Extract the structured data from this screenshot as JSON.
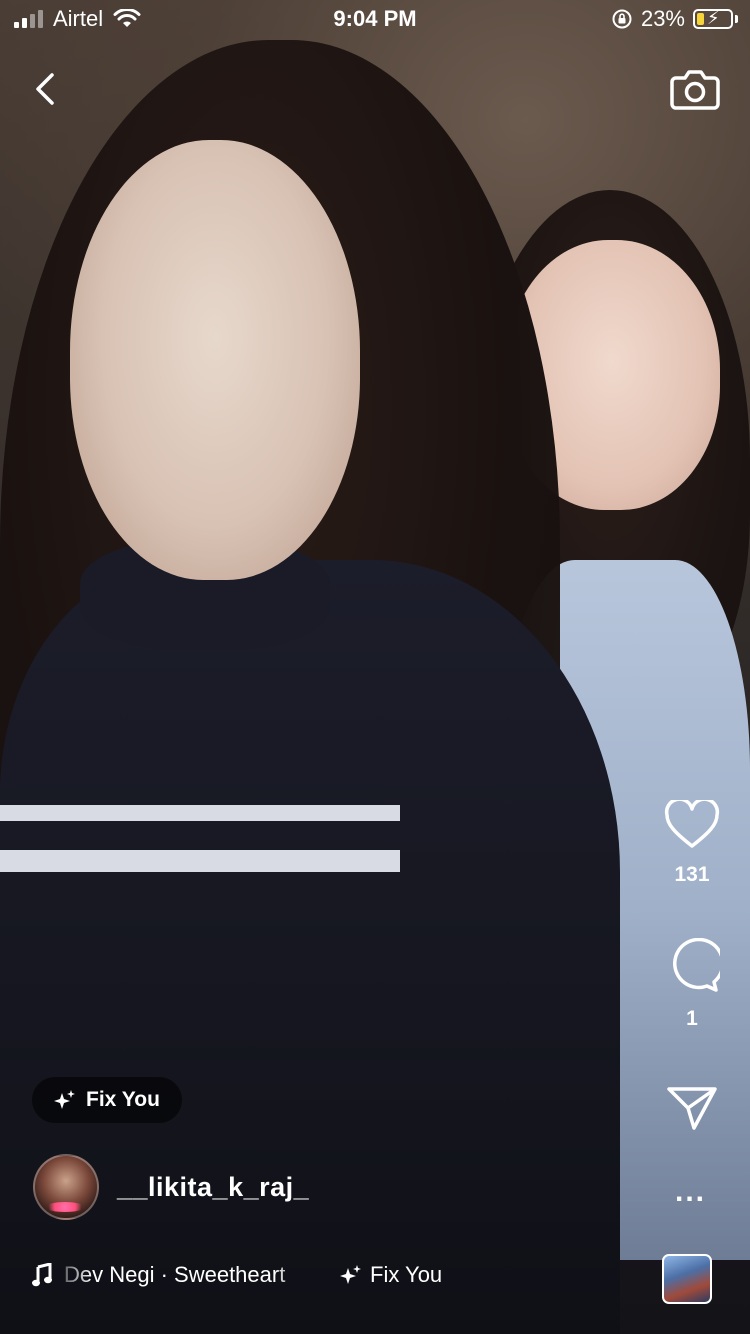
{
  "status_bar": {
    "carrier": "Airtel",
    "time": "9:04 PM",
    "battery_percent": "23%",
    "battery_level": 0.23,
    "battery_fill_color": "#f5d53a",
    "icons": [
      "signal-bars-icon",
      "wifi-icon",
      "orientation-lock-icon",
      "battery-charging-icon"
    ]
  },
  "top_bar": {
    "back_icon": "chevron-left-icon",
    "camera_icon": "camera-icon"
  },
  "actions": {
    "like_icon": "heart-icon",
    "like_count": "131",
    "comment_icon": "comment-bubble-icon",
    "comment_count": "1",
    "share_icon": "paper-plane-icon",
    "more_icon": "more-horizontal-icon",
    "more_label": "..."
  },
  "effect_chip": {
    "icon": "sparkles-icon",
    "label": "Fix You"
  },
  "author": {
    "username": "__likita_k_raj_",
    "avatar_icon": "avatar"
  },
  "audio": {
    "icon": "music-note-icon",
    "track_text": "Dev Negi · Sweetheart",
    "effect_icon": "sparkles-icon",
    "effect_label": "Fix You",
    "audio_thumbnail": "audio-thumbnail"
  }
}
